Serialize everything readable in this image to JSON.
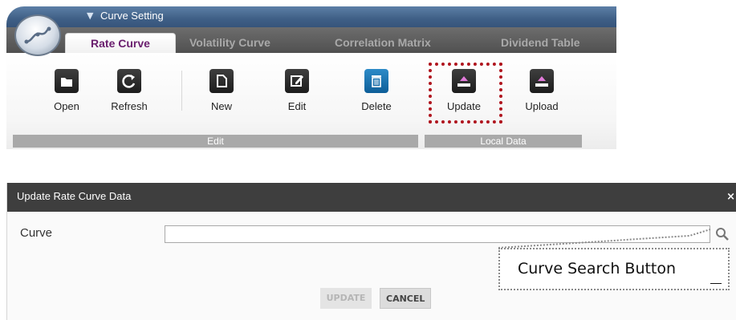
{
  "window": {
    "title": "Curve Setting"
  },
  "tabs": [
    {
      "label": "Rate Curve"
    },
    {
      "label": "Volatility Curve"
    },
    {
      "label": "Correlation Matrix"
    },
    {
      "label": "Dividend Table"
    }
  ],
  "toolbar": {
    "open": "Open",
    "refresh": "Refresh",
    "new": "New",
    "edit": "Edit",
    "delete": "Delete",
    "update": "Update",
    "upload": "Upload"
  },
  "groups": {
    "edit": "Edit",
    "local_data": "Local Data"
  },
  "dialog": {
    "title": "Update Rate Curve Data",
    "close": "×",
    "curve_label": "Curve",
    "curve_value": "",
    "update_button": "UPDATE",
    "cancel_button": "CANCEL"
  },
  "annotation": {
    "callout": "Curve Search Button"
  },
  "colors": {
    "active_tab_text": "#6a1e6e",
    "highlight_border": "#b0161f",
    "dialog_header": "#3e3e3e",
    "delete_icon": "#0d5e98"
  }
}
